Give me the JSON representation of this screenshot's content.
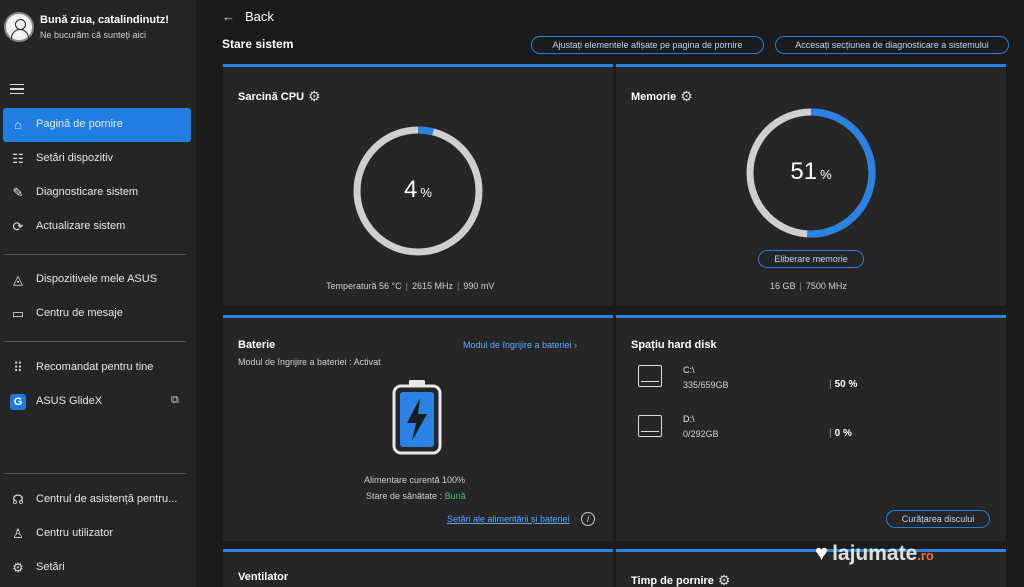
{
  "user": {
    "greeting": "Bună ziua, catalindinutz!",
    "subtitle": "Ne bucurăm că sunteți aici"
  },
  "sidebar": {
    "items": [
      {
        "label": "Pagină de pornire",
        "icon": "home-icon"
      },
      {
        "label": "Setări dispozitiv",
        "icon": "sliders-icon"
      },
      {
        "label": "Diagnosticare sistem",
        "icon": "wrench-icon"
      },
      {
        "label": "Actualizare sistem",
        "icon": "update-icon"
      },
      {
        "label": "Dispozitivele mele ASUS",
        "icon": "devices-icon"
      },
      {
        "label": "Centru de mesaje",
        "icon": "message-icon"
      },
      {
        "label": "Recomandat pentru tine",
        "icon": "grid-icon"
      },
      {
        "label": "ASUS GlideX",
        "icon": "glidex-icon"
      },
      {
        "label": "Centrul de asistență pentru...",
        "icon": "headset-icon"
      },
      {
        "label": "Centru utilizator",
        "icon": "user-icon"
      },
      {
        "label": "Setări",
        "icon": "gear-icon"
      }
    ]
  },
  "header": {
    "back_label": "Back",
    "section_title": "Stare sistem",
    "customize_label": "Ajustați elementele afișate pe pagina de pornire",
    "diagnostics_label": "Accesați secțiunea de diagnosticare a sistemului"
  },
  "cpu": {
    "title": "Sarcină CPU",
    "value": "4",
    "unit": "%",
    "percent": 4,
    "temp": "Temperatură 56 °C",
    "freq": "2615 MHz",
    "voltage": "990 mV"
  },
  "memory": {
    "title": "Memorie",
    "value": "51",
    "unit": "%",
    "percent": 51,
    "free_label": "Eliberare memorie",
    "size": "16 GB",
    "freq": "7500 MHz"
  },
  "battery": {
    "title": "Baterie",
    "care_link": "Modul de îngrijire a bateriei",
    "care_label": "Modul de îngrijire a bateriei",
    "care_status": ": Activat",
    "charge": "Alimentare curentă 100%",
    "health_label": "Stare de sănătate :",
    "health_value": "Bună",
    "settings_link": "Setări ale alimentării și bateriei"
  },
  "disk": {
    "title": "Spațiu hard disk",
    "drives": [
      {
        "name": "C:\\",
        "usage": "335/659GB",
        "pct": "50 %"
      },
      {
        "name": "D:\\",
        "usage": "0/292GB",
        "pct": "0 %"
      }
    ],
    "cleanup_label": "Curățarea discului"
  },
  "fan": {
    "title": "Ventilator"
  },
  "boot": {
    "title": "Timp de pornire"
  },
  "watermark": {
    "brand": "lajumate",
    "tld": ".ro"
  },
  "colors": {
    "accent": "#2a82e4",
    "background": "#1b1b1b",
    "card": "#262626",
    "sidebar": "#252525",
    "good": "#3cc06a"
  }
}
